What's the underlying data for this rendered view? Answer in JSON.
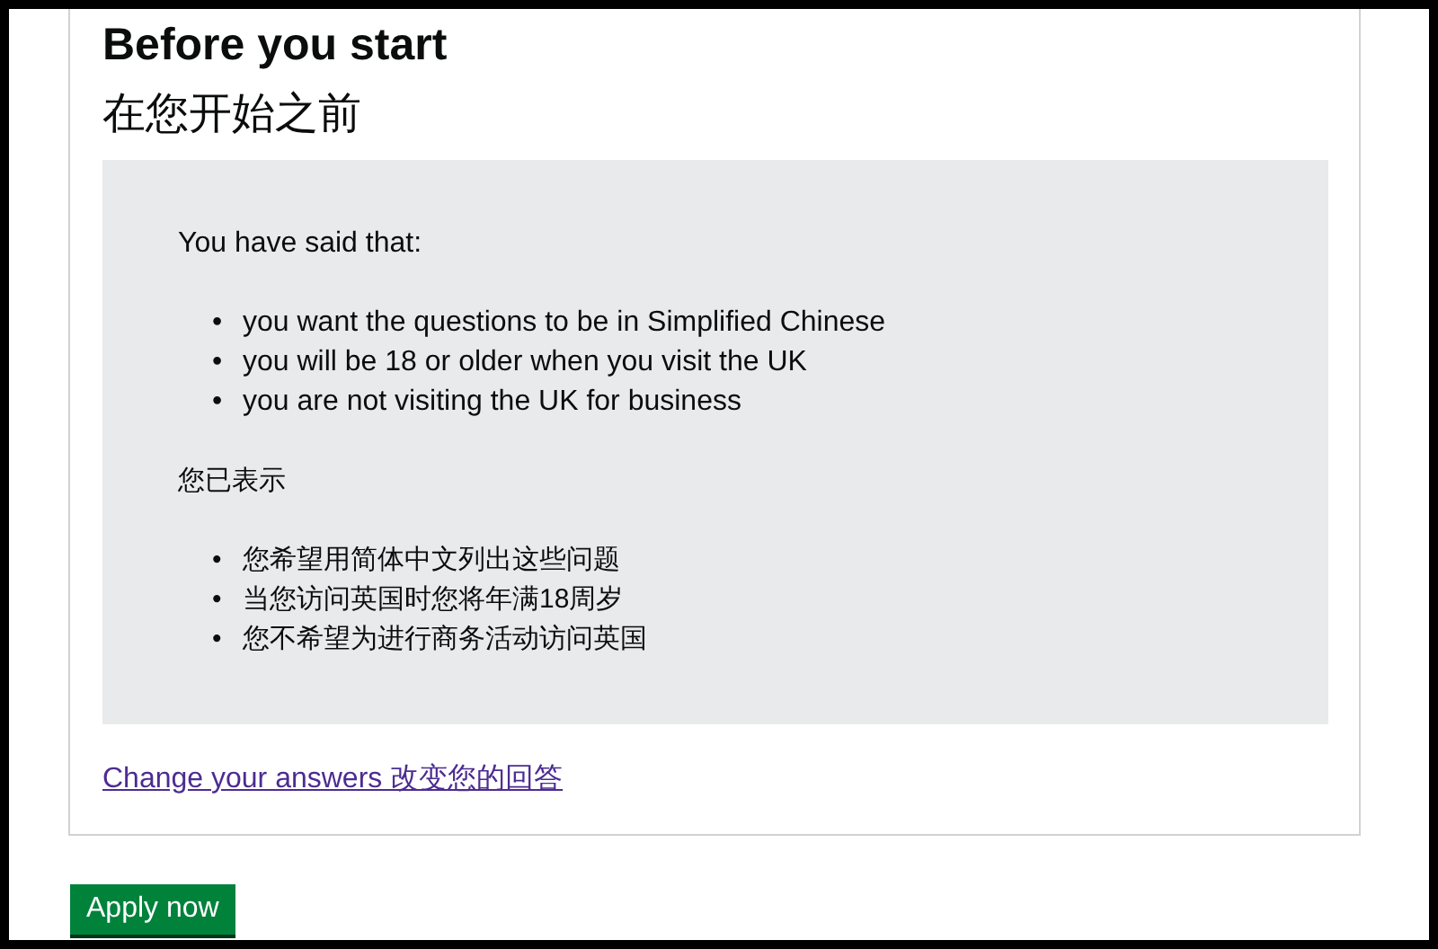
{
  "heading": "Before you start",
  "heading_zh": "在您开始之前",
  "summary": {
    "intro": "You have said that:",
    "items": [
      {
        "bullet": "•",
        "text": "you want the questions to be in Simplified Chinese"
      },
      {
        "bullet": "•",
        "text": "you will be 18 or older when you visit the UK"
      },
      {
        "bullet": "•",
        "text": "you are not visiting the UK for business"
      }
    ],
    "intro_zh": "您已表示",
    "items_zh": [
      {
        "bullet": "•",
        "text": "您希望用简体中文列出这些问题"
      },
      {
        "bullet": "•",
        "text": "当您访问英国时您将年满18周岁"
      },
      {
        "bullet": "•",
        "text": "您不希望为进行商务活动访问英国"
      }
    ]
  },
  "change_link": "Change your answers 改变您的回答",
  "button": "Apply now"
}
